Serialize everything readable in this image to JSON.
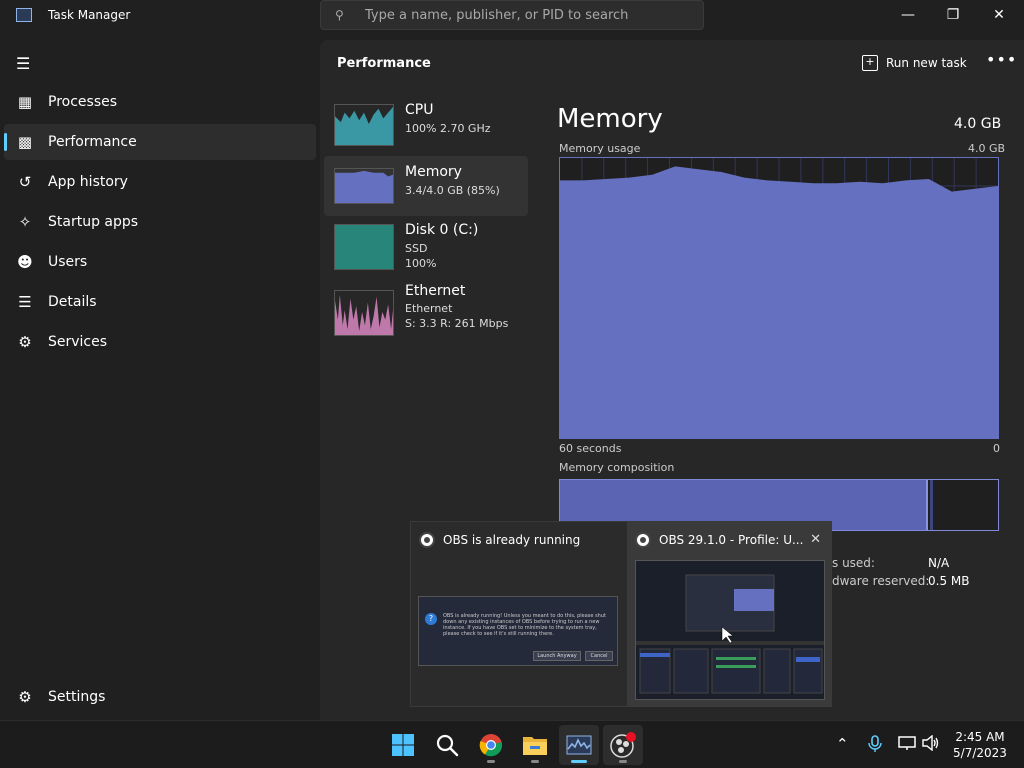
{
  "window": {
    "title": "Task Manager"
  },
  "search": {
    "placeholder": "Type a name, publisher, or PID to search"
  },
  "sidebar": {
    "items": [
      {
        "label": "Processes",
        "icon": "processes-icon"
      },
      {
        "label": "Performance",
        "icon": "performance-icon",
        "active": true
      },
      {
        "label": "App history",
        "icon": "app-history-icon"
      },
      {
        "label": "Startup apps",
        "icon": "startup-apps-icon"
      },
      {
        "label": "Users",
        "icon": "users-icon"
      },
      {
        "label": "Details",
        "icon": "details-icon"
      },
      {
        "label": "Services",
        "icon": "services-icon"
      }
    ],
    "settings_label": "Settings"
  },
  "header": {
    "title": "Performance",
    "run_new_task": "Run new task"
  },
  "perf_list": [
    {
      "name": "CPU",
      "line1": "100% 2.70 GHz",
      "line2": "",
      "color": "#3fb5c4"
    },
    {
      "name": "Memory",
      "line1": "3.4/4.0 GB (85%)",
      "line2": "",
      "color": "#6670c0"
    },
    {
      "name": "Disk 0 (C:)",
      "line1": "SSD",
      "line2": "100%",
      "color": "#2aa597"
    },
    {
      "name": "Ethernet",
      "line1": "Ethernet",
      "line2": "S: 3.3 R: 261 Mbps",
      "color": "#d987c2"
    }
  ],
  "memory": {
    "title": "Memory",
    "total": "4.0 GB",
    "usage_label": "Memory usage",
    "usage_max": "4.0 GB",
    "time_left": "60 seconds",
    "time_right": "0",
    "composition_label": "Memory composition",
    "usage_fraction": 0.85,
    "stats": [
      {
        "label": "s used:",
        "value": "N/A"
      },
      {
        "label": "dware reserved:",
        "value": "0.5 MB"
      }
    ]
  },
  "popup": {
    "card1_title": "OBS is already running",
    "card1_text": "OBS is already running! Unless you meant to do this, please shut down any existing instances of OBS before trying to run a new instance. If you have OBS set to minimize to the system tray, please check to see if it's still running there.",
    "card1_launch": "Launch Anyway",
    "card1_cancel": "Cancel",
    "card2_title": "OBS 29.1.0 - Profile: U..."
  },
  "taskbar": {
    "time": "2:45 AM",
    "date": "5/7/2023"
  },
  "colors": {
    "accent": "#60cdff",
    "memory": "#6670c0"
  }
}
